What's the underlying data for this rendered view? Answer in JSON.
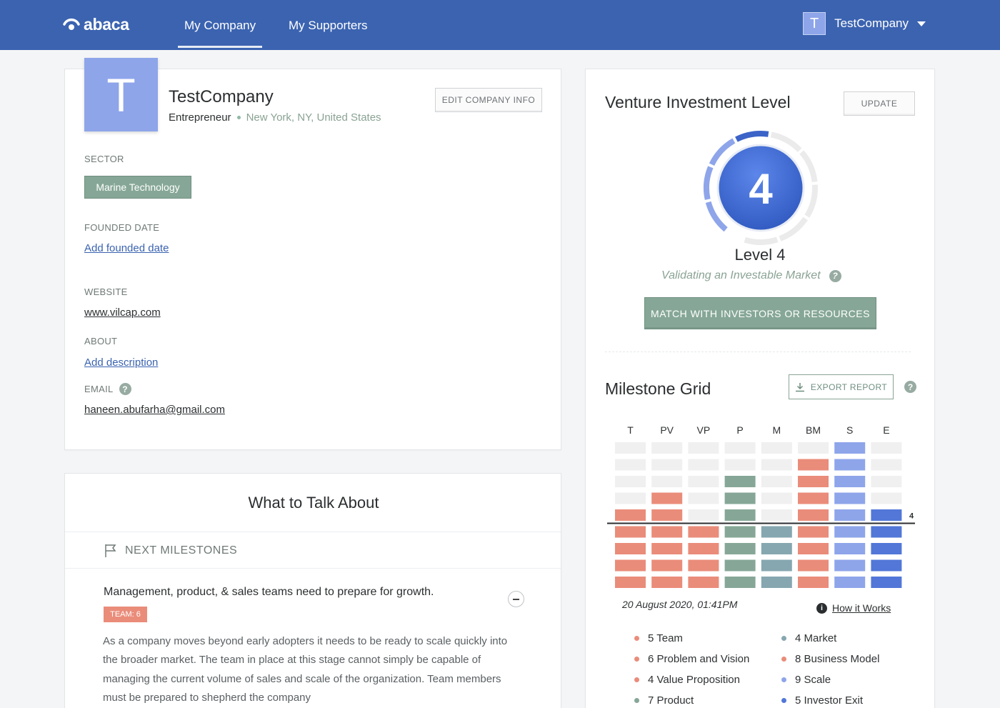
{
  "app": {
    "logo_text": "abaca"
  },
  "nav": {
    "tabs": [
      {
        "label": "My Company"
      },
      {
        "label": "My Supporters"
      }
    ],
    "user": {
      "initial": "T",
      "name": "TestCompany"
    }
  },
  "company": {
    "initial": "T",
    "name": "TestCompany",
    "type": "Entrepreneur",
    "location": "New York, NY, United States",
    "edit_label": "EDIT COMPANY INFO",
    "sector_label": "SECTOR",
    "sector": "Marine Technology",
    "founded_label": "FOUNDED DATE",
    "founded_action": "Add founded date",
    "website_label": "WEBSITE",
    "website": "www.vilcap.com",
    "about_label": "ABOUT",
    "about_action": "Add description",
    "email_label": "EMAIL",
    "email": "haneen.abufarha@gmail.com"
  },
  "talk": {
    "title": "What to Talk About",
    "section_label": "NEXT MILESTONES",
    "milestone_title": "Management, product, & sales teams need to prepare for growth.",
    "badge": "TEAM: 6",
    "description": "As a company moves beyond early adopters it needs to be ready to scale quickly into the broader market. The team in place at this stage cannot simply be capable of managing the current volume of sales and scale of the organization. Team members must be prepared to shepherd the company"
  },
  "vil": {
    "title": "Venture Investment Level",
    "update_label": "UPDATE",
    "level_number": "4",
    "level_text": "Level 4",
    "level_subtitle": "Validating an Investable Market",
    "match_label": "MATCH WITH INVESTORS OR RESOURCES"
  },
  "milestone_grid": {
    "title": "Milestone Grid",
    "export_label": "EXPORT REPORT",
    "columns": [
      "T",
      "PV",
      "VP",
      "P",
      "M",
      "BM",
      "S",
      "E"
    ],
    "column_levels": [
      5,
      6,
      4,
      7,
      4,
      8,
      9,
      5
    ],
    "column_colors": [
      "#ea8c7a",
      "#ea8c7a",
      "#ea8c7a",
      "#86a797",
      "#86a7b0",
      "#ea8c7a",
      "#8ea5ea",
      "#5277d8"
    ],
    "empty_color": "#f0f0f0",
    "rows": 9,
    "threshold_level": 4,
    "threshold_label": "4",
    "timestamp": "20 August 2020, 01:41PM",
    "how_it_works": "How it Works",
    "legend": [
      {
        "label": "5 Team",
        "color": "#ea8c7a"
      },
      {
        "label": "4 Market",
        "color": "#86a7b0"
      },
      {
        "label": "6 Problem and Vision",
        "color": "#ea8c7a"
      },
      {
        "label": "8 Business Model",
        "color": "#ea8c7a"
      },
      {
        "label": "4 Value Proposition",
        "color": "#ea8c7a"
      },
      {
        "label": "9 Scale",
        "color": "#8ea5ea"
      },
      {
        "label": "7 Product",
        "color": "#86a797"
      },
      {
        "label": "5 Investor Exit",
        "color": "#5277d8"
      }
    ]
  }
}
